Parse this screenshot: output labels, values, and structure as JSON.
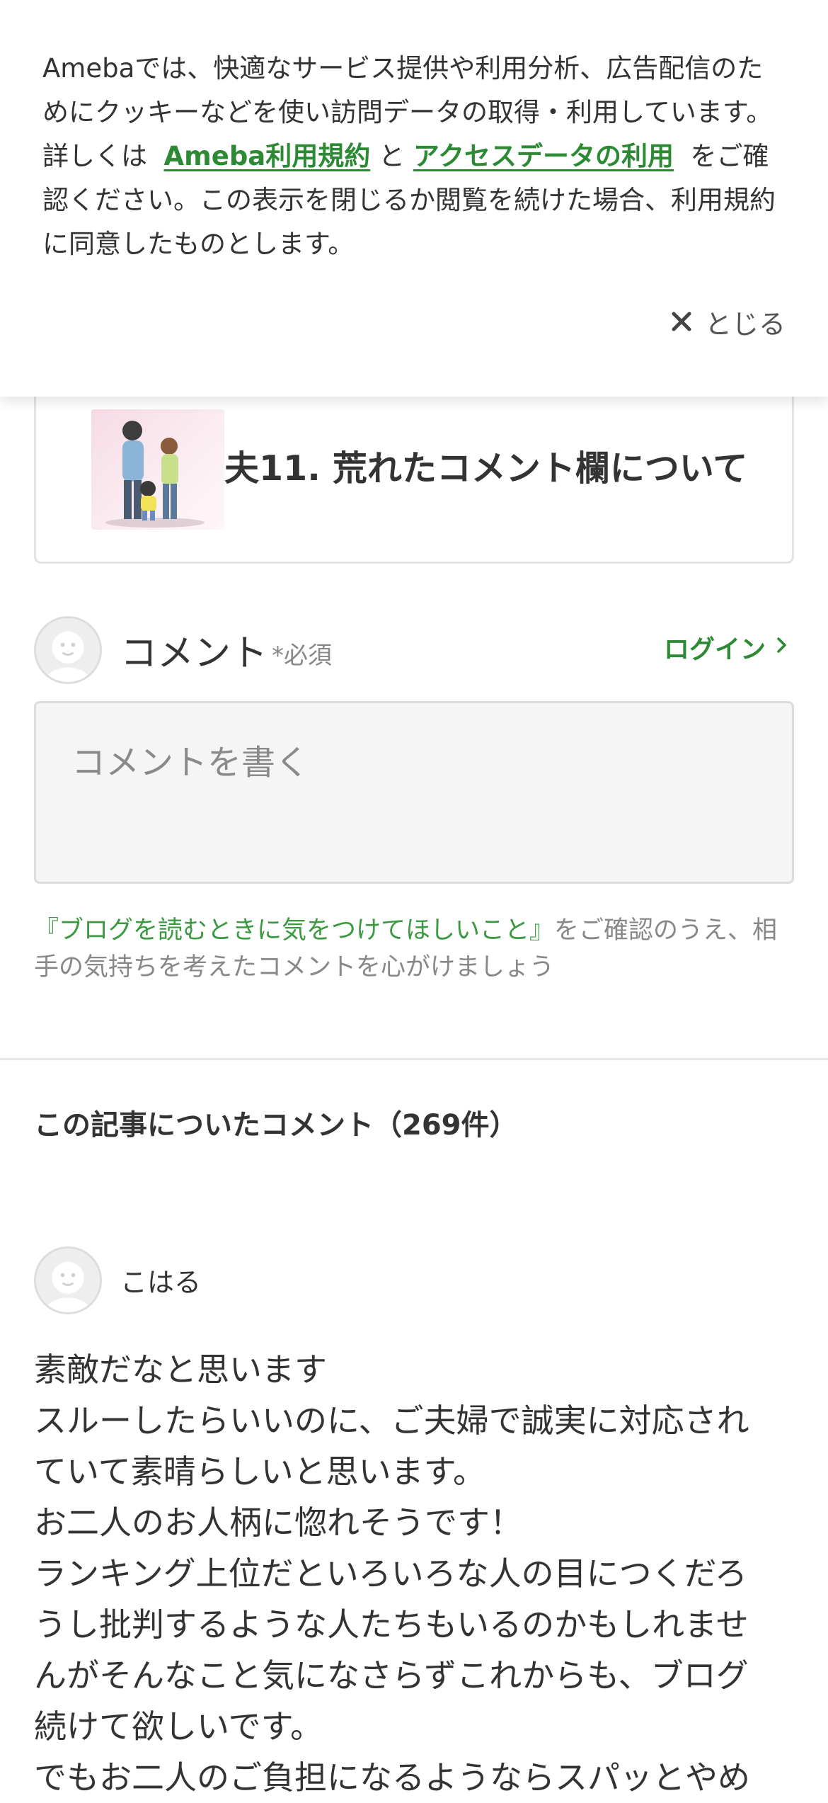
{
  "cookie_banner": {
    "text_1": "Amebaでは、快適なサービス提供や利用分析、広告配信のためにクッキーなどを使い訪問データの取得・利用しています。詳しくは",
    "link_terms": "Ameba利用規約",
    "text_2": "と",
    "link_access_data": "アクセスデータの利用",
    "text_3": "をご確認ください。この表示を閉じるか閲覧を続けた場合、利用規約に同意したものとします。",
    "close_label": "とじる"
  },
  "article": {
    "title": "夫11. 荒れたコメント欄について"
  },
  "comment_form": {
    "label": "コメント",
    "required": "*必須",
    "login_label": "ログイン",
    "placeholder": "コメントを書く",
    "guideline_link": "『ブログを読むときに気をつけてほしいこと』",
    "guideline_text": "をご確認のうえ、相手の気持ちを考えたコメントを心がけましょう"
  },
  "comments": {
    "heading": "この記事についたコメント（269件）",
    "items": [
      {
        "author": "こはる",
        "lines": [
          "素敵だなと思います",
          "スルーしたらいいのに、ご夫婦で誠実に対応され",
          "ていて素晴らしいと思います。",
          "お二人のお人柄に惚れそうです！",
          "ランキング上位だといろいろな人の目につくだろ",
          "うし批判するような人たちもいるのかもしれませ",
          "んがそんなこと気になさらずこれからも、ブログ",
          "続けて欲しいです。",
          "でもお二人のご負担になるようならスパッとやめ"
        ]
      }
    ]
  },
  "colors": {
    "accent_green": "#2d8a34",
    "text": "#333333",
    "muted": "#888888"
  },
  "icons": {
    "close": "close-icon",
    "login_chevron": "chevron-right-icon",
    "default_avatar": "default-avatar-icon"
  }
}
